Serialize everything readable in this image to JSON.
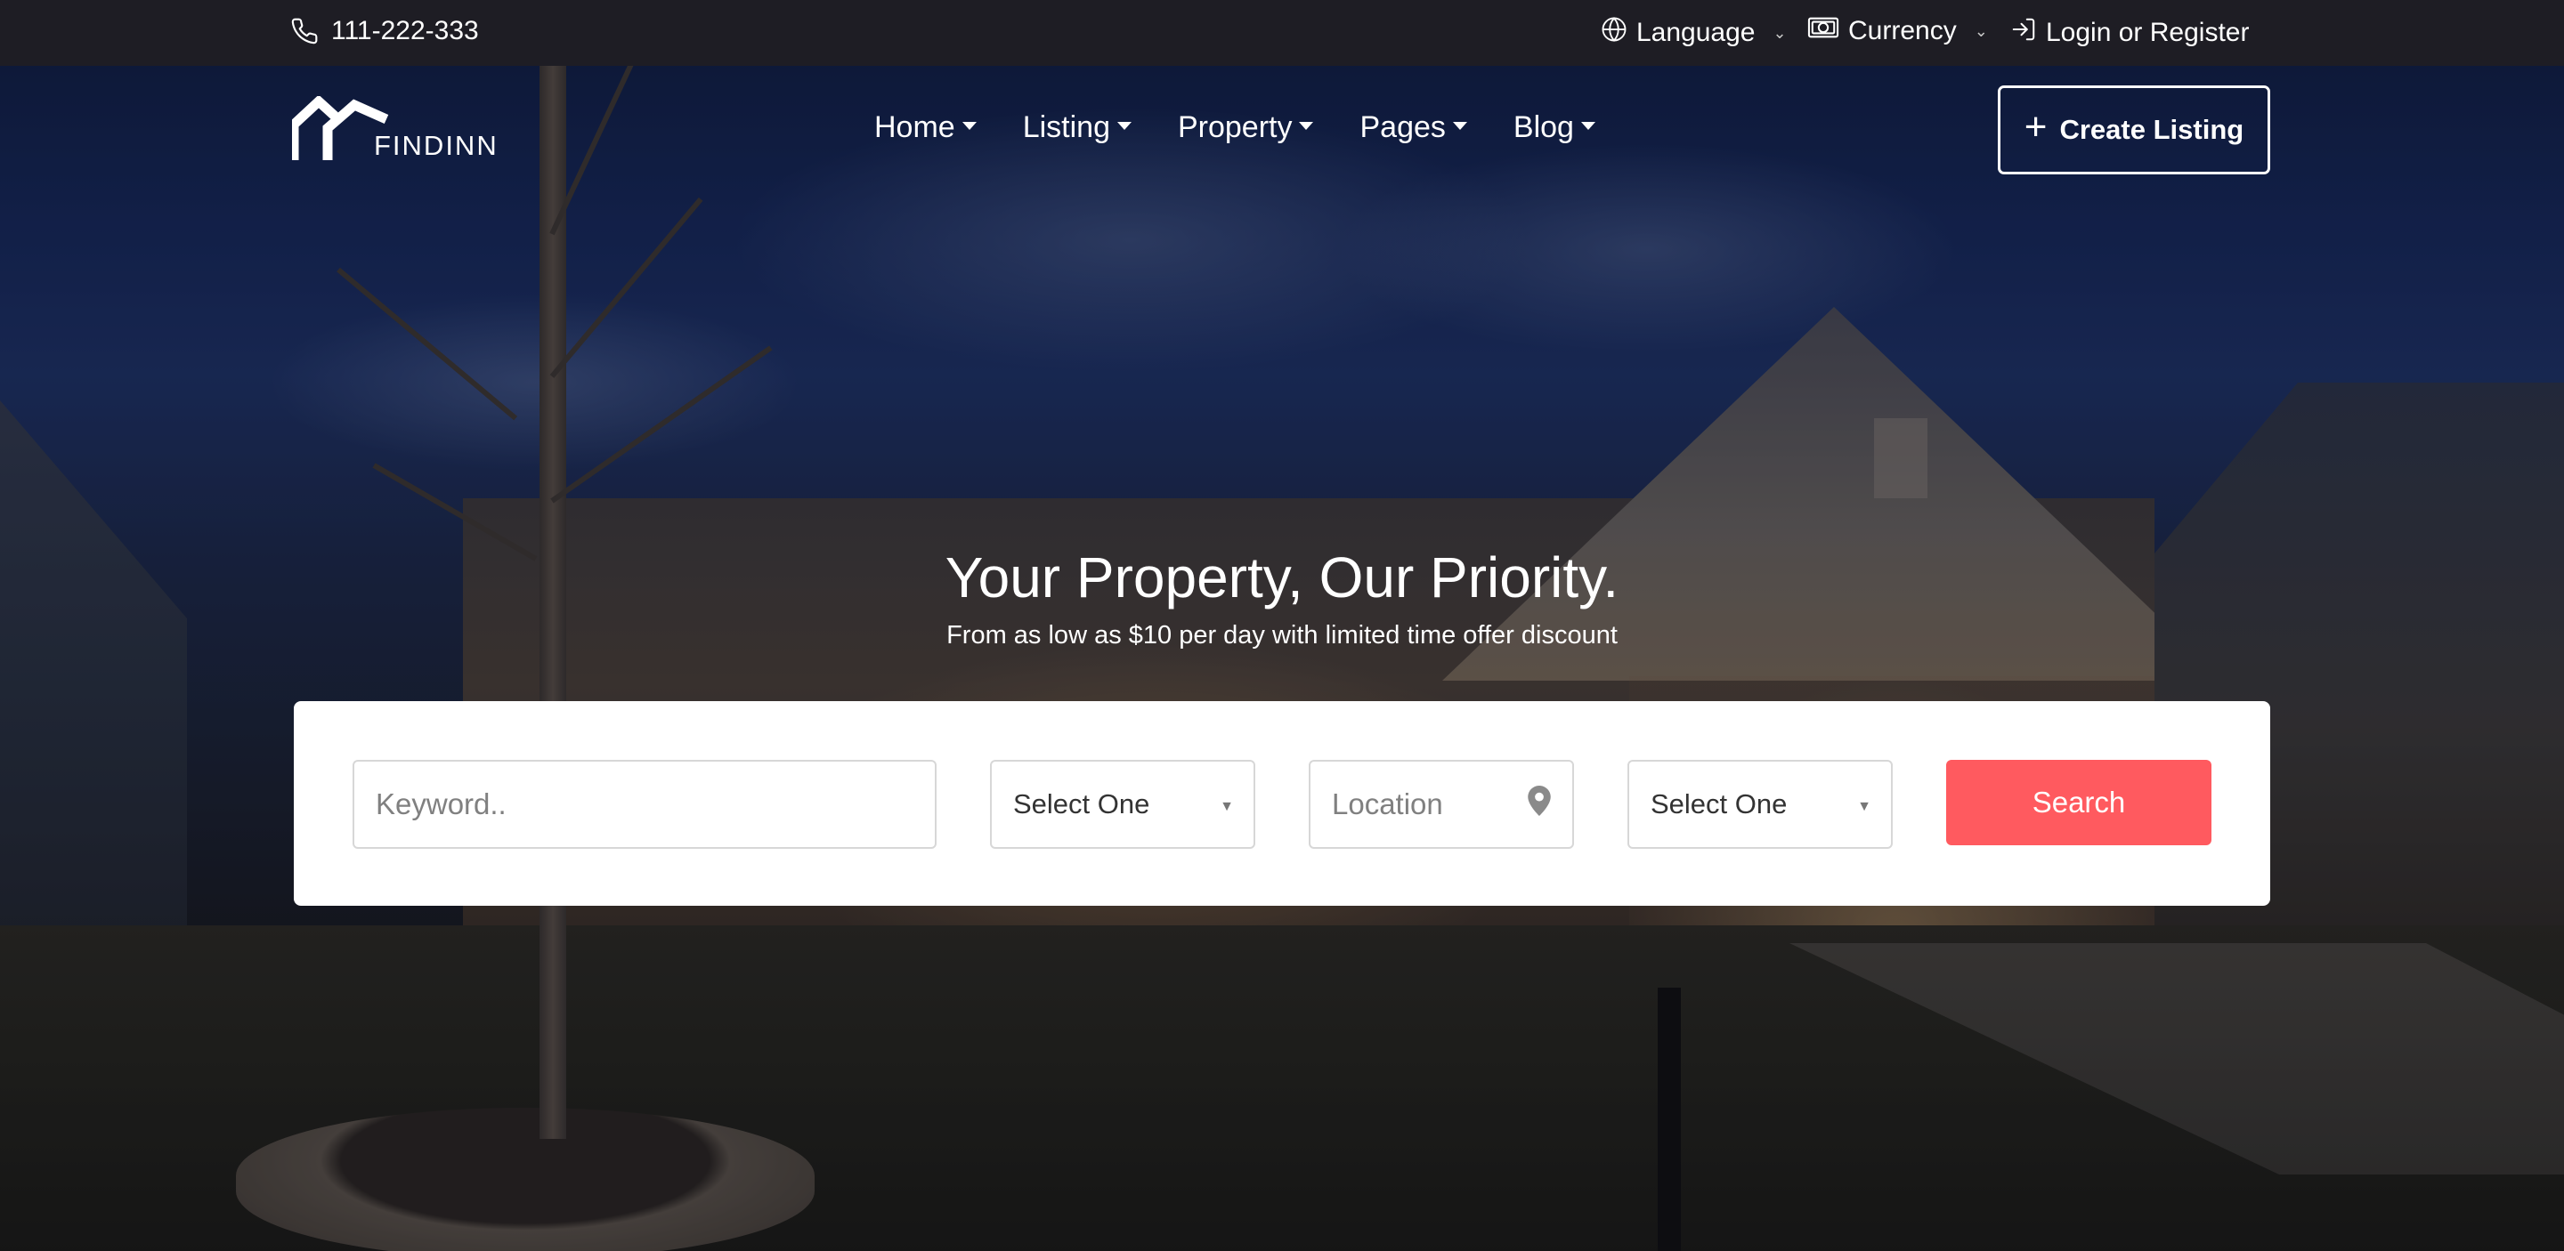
{
  "topbar": {
    "phone": "111-222-333",
    "language_label": "Language",
    "currency_label": "Currency",
    "login_label": "Login or Register"
  },
  "brand": {
    "name": "FINDINN"
  },
  "nav": {
    "items": [
      {
        "label": "Home"
      },
      {
        "label": "Listing"
      },
      {
        "label": "Property"
      },
      {
        "label": "Pages"
      },
      {
        "label": "Blog"
      }
    ],
    "create_listing_label": "Create Listing"
  },
  "hero": {
    "title": "Your Property, Our Priority.",
    "subtitle": "From as low as $10 per day with limited time offer discount"
  },
  "search": {
    "keyword_placeholder": "Keyword..",
    "select1_value": "Select One",
    "location_placeholder": "Location",
    "select2_value": "Select One",
    "button_label": "Search"
  },
  "colors": {
    "topbar_bg": "#1e1d24",
    "accent": "#ff5a5f",
    "card_bg": "#ffffff"
  },
  "icons": {
    "phone": "phone-icon",
    "language": "globe-icon",
    "currency": "banknote-icon",
    "login": "login-icon",
    "create": "plus-icon",
    "location": "map-pin-icon"
  }
}
